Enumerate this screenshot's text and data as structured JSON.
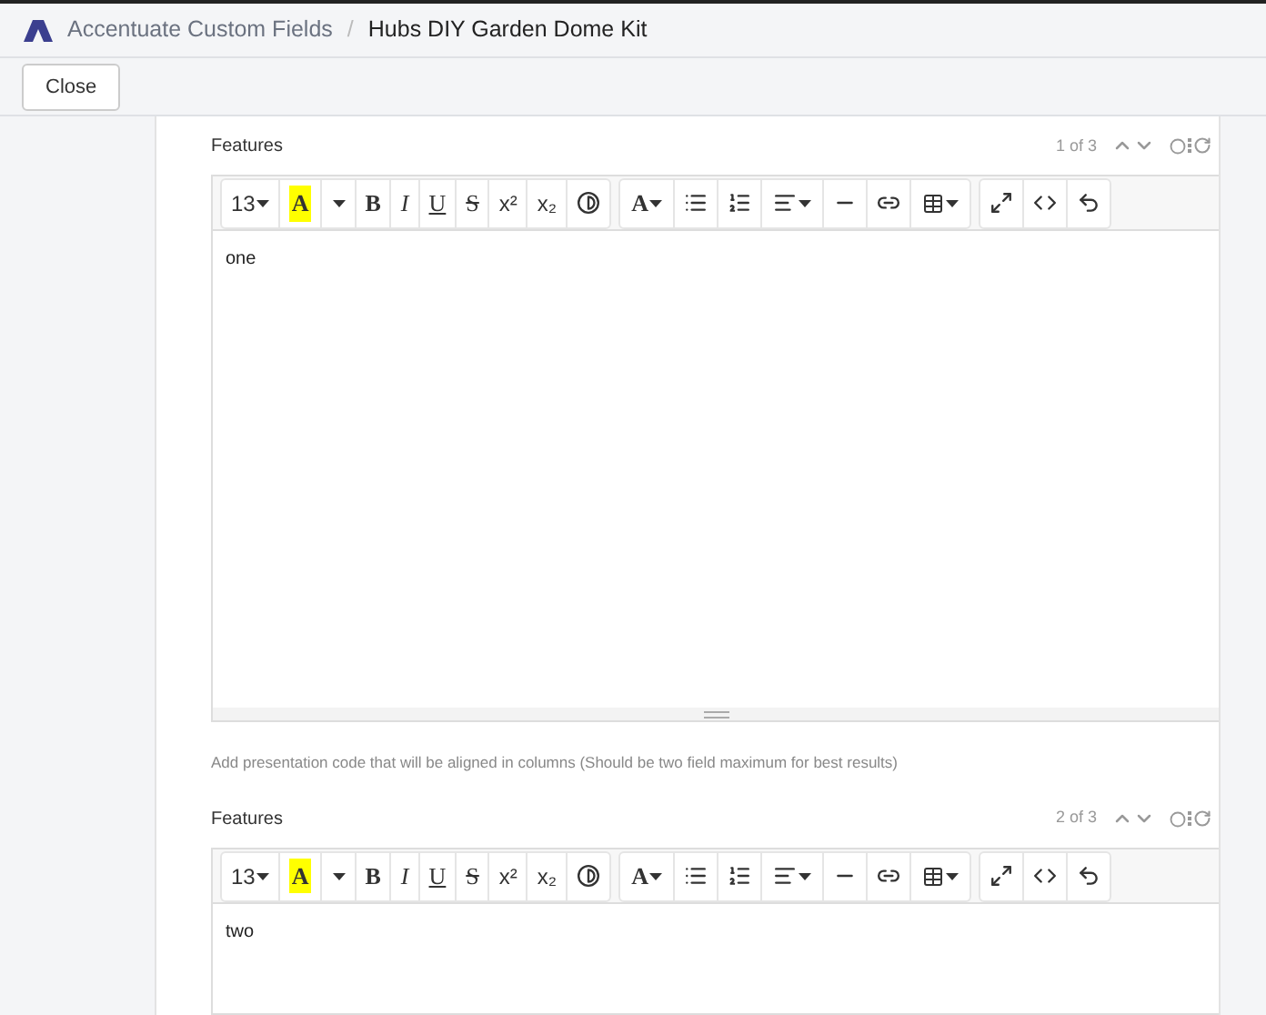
{
  "breadcrumb": {
    "parent": "Accentuate Custom Fields",
    "separator": "/",
    "current": "Hubs DIY Garden Dome Kit"
  },
  "close_button": "Close",
  "editors": [
    {
      "label": "Features",
      "counter": "1 of 3",
      "content": "one",
      "hint": "Add presentation code that will be aligned in columns (Should be two field maximum for best results)",
      "toolbar": [
        [
          {
            "kind": "size",
            "text": "13"
          },
          {
            "kind": "highlight",
            "text": "A"
          },
          {
            "kind": "caret"
          },
          {
            "kind": "bold",
            "text": "B"
          },
          {
            "kind": "italic",
            "text": "I"
          },
          {
            "kind": "underline",
            "text": "U"
          },
          {
            "kind": "strike",
            "text": "S"
          },
          {
            "kind": "sup",
            "text": "x²"
          },
          {
            "kind": "sub",
            "text": "x₂"
          },
          {
            "kind": "contrast"
          }
        ],
        [
          {
            "kind": "color",
            "text": "A"
          },
          {
            "kind": "bullets"
          },
          {
            "kind": "numbers"
          },
          {
            "kind": "align"
          },
          {
            "kind": "rule"
          },
          {
            "kind": "link"
          },
          {
            "kind": "table"
          }
        ],
        [
          {
            "kind": "fullscreen"
          },
          {
            "kind": "code"
          },
          {
            "kind": "undo"
          }
        ]
      ]
    },
    {
      "label": "Features",
      "counter": "2 of 3",
      "content": "two",
      "toolbar": [
        [
          {
            "kind": "size",
            "text": "13"
          },
          {
            "kind": "highlight",
            "text": "A"
          },
          {
            "kind": "caret"
          },
          {
            "kind": "bold",
            "text": "B"
          },
          {
            "kind": "italic",
            "text": "I"
          },
          {
            "kind": "underline",
            "text": "U"
          },
          {
            "kind": "strike",
            "text": "S"
          },
          {
            "kind": "sup",
            "text": "x²"
          },
          {
            "kind": "sub",
            "text": "x₂"
          },
          {
            "kind": "contrast"
          }
        ],
        [
          {
            "kind": "color",
            "text": "A"
          },
          {
            "kind": "bullets"
          },
          {
            "kind": "numbers"
          },
          {
            "kind": "align"
          },
          {
            "kind": "rule"
          },
          {
            "kind": "link"
          },
          {
            "kind": "table"
          }
        ],
        [
          {
            "kind": "fullscreen"
          },
          {
            "kind": "code"
          },
          {
            "kind": "undo"
          }
        ]
      ]
    }
  ]
}
